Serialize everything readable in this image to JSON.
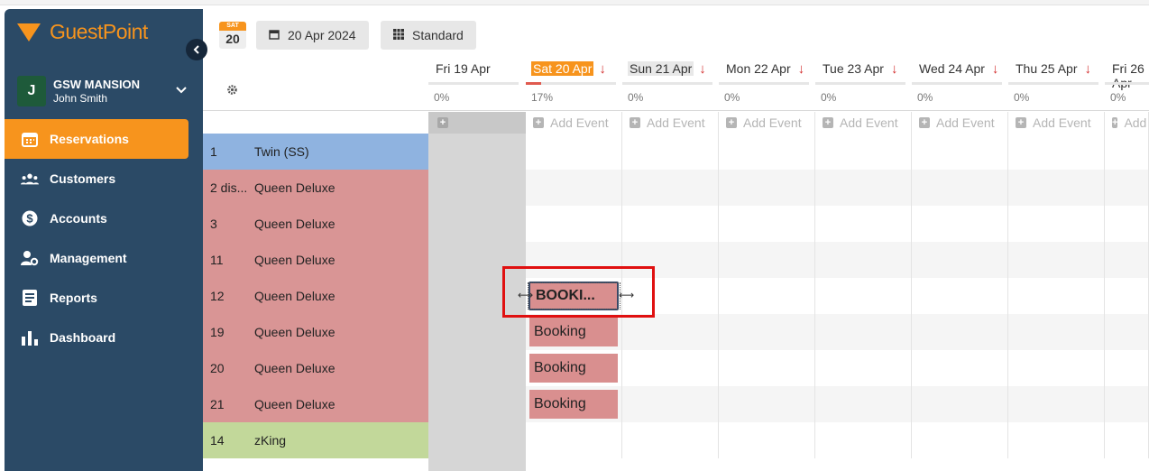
{
  "logo": {
    "text": "GuestPoint"
  },
  "property": {
    "initial": "J",
    "name": "GSW MANSION",
    "user": "John Smith"
  },
  "nav": [
    {
      "label": "Reservations",
      "icon": "calendar-icon",
      "active": true
    },
    {
      "label": "Customers",
      "icon": "users-icon"
    },
    {
      "label": "Accounts",
      "icon": "dollar-icon"
    },
    {
      "label": "Management",
      "icon": "user-gear-icon"
    },
    {
      "label": "Reports",
      "icon": "document-icon"
    },
    {
      "label": "Dashboard",
      "icon": "bar-chart-icon"
    }
  ],
  "toolbar": {
    "badge_day": "SAT",
    "badge_num": "20",
    "date_label": "20 Apr 2024",
    "view_label": "Standard"
  },
  "days": [
    {
      "label": "Fri 19 Apr",
      "pct": "0%",
      "arrow": false,
      "style": "past",
      "occupancy": 0
    },
    {
      "label": "Sat 20 Apr",
      "pct": "17%",
      "arrow": true,
      "style": "today",
      "occupancy": 17
    },
    {
      "label": "Sun 21 Apr",
      "pct": "0%",
      "arrow": true,
      "style": "weekend",
      "occupancy": 0
    },
    {
      "label": "Mon 22 Apr",
      "pct": "0%",
      "arrow": true,
      "style": "",
      "occupancy": 0
    },
    {
      "label": "Tue 23 Apr",
      "pct": "0%",
      "arrow": true,
      "style": "",
      "occupancy": 0
    },
    {
      "label": "Wed 24 Apr",
      "pct": "0%",
      "arrow": true,
      "style": "",
      "occupancy": 0
    },
    {
      "label": "Thu 25 Apr",
      "pct": "0%",
      "arrow": true,
      "style": "",
      "occupancy": 0
    },
    {
      "label": "Fri 26 Apr",
      "pct": "0%",
      "arrow": false,
      "style": "",
      "occupancy": 0
    }
  ],
  "add_event_label": "Add Event",
  "rooms": [
    {
      "number": "1",
      "type": "Twin (SS)",
      "color": "#8fb3e0"
    },
    {
      "number": "2 dis...",
      "type": "Queen Deluxe",
      "color": "#d99595"
    },
    {
      "number": "3",
      "type": "Queen Deluxe",
      "color": "#d99595"
    },
    {
      "number": "11",
      "type": "Queen Deluxe",
      "color": "#d99595"
    },
    {
      "number": "12",
      "type": "Queen Deluxe",
      "color": "#d99595"
    },
    {
      "number": "19",
      "type": "Queen Deluxe",
      "color": "#d99595"
    },
    {
      "number": "20",
      "type": "Queen Deluxe",
      "color": "#d99595"
    },
    {
      "number": "21",
      "type": "Queen Deluxe",
      "color": "#d99595"
    },
    {
      "number": "14",
      "type": "zKing",
      "color": "#c2d89a"
    }
  ],
  "bookings": [
    {
      "row": 4,
      "label": "BOOKI...",
      "selected": true
    },
    {
      "row": 5,
      "label": "Booking"
    },
    {
      "row": 6,
      "label": "Booking"
    },
    {
      "row": 7,
      "label": "Booking"
    }
  ],
  "colors": {
    "accent": "#f7941d",
    "sidebar": "#2b4a66",
    "booking": "#d98f8f",
    "highlight": "#e01010"
  }
}
